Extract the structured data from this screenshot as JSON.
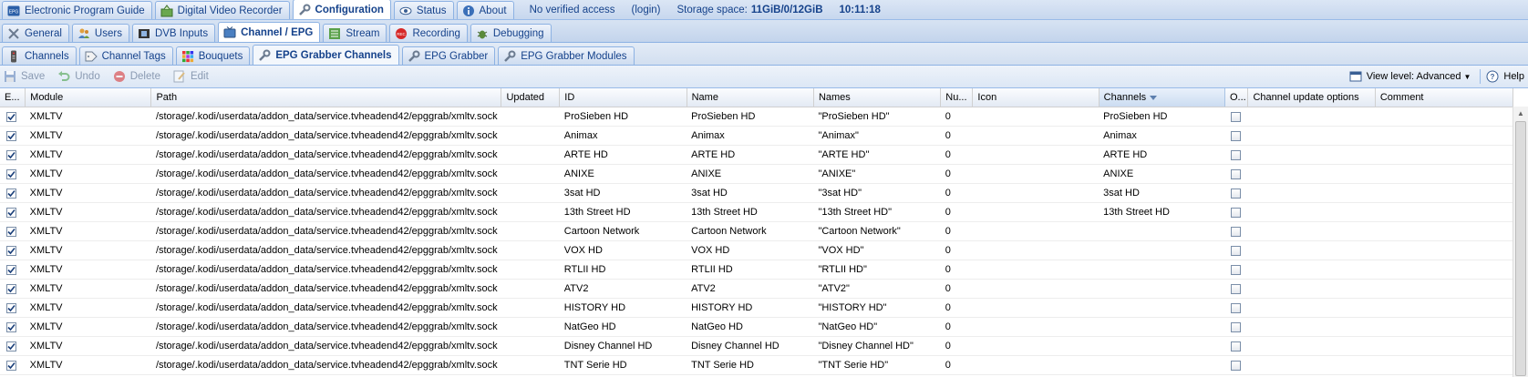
{
  "app": {
    "top_tabs": [
      {
        "label": "Electronic Program Guide",
        "icon": "epg-icon"
      },
      {
        "label": "Digital Video Recorder",
        "icon": "dvr-icon"
      },
      {
        "label": "Configuration",
        "icon": "wrench-icon"
      },
      {
        "label": "Status",
        "icon": "eye-icon"
      },
      {
        "label": "About",
        "icon": "info-icon"
      }
    ],
    "status": {
      "access": "No verified access",
      "login": "(login)",
      "storage_label": "Storage space:",
      "storage_value": "11GiB/0/12GiB",
      "clock": "10:11:18"
    }
  },
  "config_tabs": [
    {
      "label": "General",
      "icon": "tools-icon"
    },
    {
      "label": "Users",
      "icon": "users-icon"
    },
    {
      "label": "DVB Inputs",
      "icon": "film-icon"
    },
    {
      "label": "Channel / EPG",
      "icon": "tv-icon"
    },
    {
      "label": "Stream",
      "icon": "stream-icon"
    },
    {
      "label": "Recording",
      "icon": "rec-icon"
    },
    {
      "label": "Debugging",
      "icon": "bug-icon"
    }
  ],
  "sub_tabs": [
    {
      "label": "Channels",
      "icon": "remote-icon"
    },
    {
      "label": "Channel Tags",
      "icon": "tags-icon"
    },
    {
      "label": "Bouquets",
      "icon": "bouquet-icon"
    },
    {
      "label": "EPG Grabber Channels",
      "icon": "grabber-channels-icon"
    },
    {
      "label": "EPG Grabber",
      "icon": "grabber-icon"
    },
    {
      "label": "EPG Grabber Modules",
      "icon": "modules-icon"
    }
  ],
  "toolbar": {
    "save": "Save",
    "undo": "Undo",
    "delete": "Delete",
    "edit": "Edit",
    "view_level": "View level: Advanced",
    "help": "Help"
  },
  "grid": {
    "columns": [
      "E...",
      "Module",
      "Path",
      "Updated",
      "ID",
      "Name",
      "Names",
      "Nu...",
      "Icon",
      "Channels",
      "O...",
      "Channel update options",
      "Comment"
    ],
    "rows": [
      {
        "enabled": true,
        "module": "XMLTV",
        "path": "/storage/.kodi/userdata/addon_data/service.tvheadend42/epggrab/xmltv.sock",
        "updated": "",
        "id": "ProSieben HD",
        "name": "ProSieben HD",
        "names": "\"ProSieben HD\"",
        "num": "0",
        "icon": "",
        "channels": "ProSieben HD",
        "once": false,
        "options": "",
        "comment": ""
      },
      {
        "enabled": true,
        "module": "XMLTV",
        "path": "/storage/.kodi/userdata/addon_data/service.tvheadend42/epggrab/xmltv.sock",
        "updated": "",
        "id": "Animax",
        "name": "Animax",
        "names": "\"Animax\"",
        "num": "0",
        "icon": "",
        "channels": "Animax",
        "once": false,
        "options": "",
        "comment": ""
      },
      {
        "enabled": true,
        "module": "XMLTV",
        "path": "/storage/.kodi/userdata/addon_data/service.tvheadend42/epggrab/xmltv.sock",
        "updated": "",
        "id": "ARTE HD",
        "name": "ARTE HD",
        "names": "\"ARTE HD\"",
        "num": "0",
        "icon": "",
        "channels": "ARTE HD",
        "once": false,
        "options": "",
        "comment": ""
      },
      {
        "enabled": true,
        "module": "XMLTV",
        "path": "/storage/.kodi/userdata/addon_data/service.tvheadend42/epggrab/xmltv.sock",
        "updated": "",
        "id": "ANIXE",
        "name": "ANIXE",
        "names": "\"ANIXE\"",
        "num": "0",
        "icon": "",
        "channels": "ANIXE",
        "once": false,
        "options": "",
        "comment": ""
      },
      {
        "enabled": true,
        "module": "XMLTV",
        "path": "/storage/.kodi/userdata/addon_data/service.tvheadend42/epggrab/xmltv.sock",
        "updated": "",
        "id": "3sat HD",
        "name": "3sat HD",
        "names": "\"3sat HD\"",
        "num": "0",
        "icon": "",
        "channels": "3sat HD",
        "once": false,
        "options": "",
        "comment": ""
      },
      {
        "enabled": true,
        "module": "XMLTV",
        "path": "/storage/.kodi/userdata/addon_data/service.tvheadend42/epggrab/xmltv.sock",
        "updated": "",
        "id": "13th Street HD",
        "name": "13th Street HD",
        "names": "\"13th Street HD\"",
        "num": "0",
        "icon": "",
        "channels": "13th Street HD",
        "once": false,
        "options": "",
        "comment": ""
      },
      {
        "enabled": true,
        "module": "XMLTV",
        "path": "/storage/.kodi/userdata/addon_data/service.tvheadend42/epggrab/xmltv.sock",
        "updated": "",
        "id": "Cartoon Network",
        "name": "Cartoon Network",
        "names": "\"Cartoon Network\"",
        "num": "0",
        "icon": "",
        "channels": "",
        "once": false,
        "options": "",
        "comment": ""
      },
      {
        "enabled": true,
        "module": "XMLTV",
        "path": "/storage/.kodi/userdata/addon_data/service.tvheadend42/epggrab/xmltv.sock",
        "updated": "",
        "id": "VOX HD",
        "name": "VOX HD",
        "names": "\"VOX HD\"",
        "num": "0",
        "icon": "",
        "channels": "",
        "once": false,
        "options": "",
        "comment": ""
      },
      {
        "enabled": true,
        "module": "XMLTV",
        "path": "/storage/.kodi/userdata/addon_data/service.tvheadend42/epggrab/xmltv.sock",
        "updated": "",
        "id": "RTLII HD",
        "name": "RTLII HD",
        "names": "\"RTLII HD\"",
        "num": "0",
        "icon": "",
        "channels": "",
        "once": false,
        "options": "",
        "comment": ""
      },
      {
        "enabled": true,
        "module": "XMLTV",
        "path": "/storage/.kodi/userdata/addon_data/service.tvheadend42/epggrab/xmltv.sock",
        "updated": "",
        "id": "ATV2",
        "name": "ATV2",
        "names": "\"ATV2\"",
        "num": "0",
        "icon": "",
        "channels": "",
        "once": false,
        "options": "",
        "comment": ""
      },
      {
        "enabled": true,
        "module": "XMLTV",
        "path": "/storage/.kodi/userdata/addon_data/service.tvheadend42/epggrab/xmltv.sock",
        "updated": "",
        "id": "HISTORY HD",
        "name": "HISTORY HD",
        "names": "\"HISTORY HD\"",
        "num": "0",
        "icon": "",
        "channels": "",
        "once": false,
        "options": "",
        "comment": ""
      },
      {
        "enabled": true,
        "module": "XMLTV",
        "path": "/storage/.kodi/userdata/addon_data/service.tvheadend42/epggrab/xmltv.sock",
        "updated": "",
        "id": "NatGeo HD",
        "name": "NatGeo HD",
        "names": "\"NatGeo HD\"",
        "num": "0",
        "icon": "",
        "channels": "",
        "once": false,
        "options": "",
        "comment": ""
      },
      {
        "enabled": true,
        "module": "XMLTV",
        "path": "/storage/.kodi/userdata/addon_data/service.tvheadend42/epggrab/xmltv.sock",
        "updated": "",
        "id": "Disney Channel HD",
        "name": "Disney Channel HD",
        "names": "\"Disney Channel HD\"",
        "num": "0",
        "icon": "",
        "channels": "",
        "once": false,
        "options": "",
        "comment": ""
      },
      {
        "enabled": true,
        "module": "XMLTV",
        "path": "/storage/.kodi/userdata/addon_data/service.tvheadend42/epggrab/xmltv.sock",
        "updated": "",
        "id": "TNT Serie HD",
        "name": "TNT Serie HD",
        "names": "\"TNT Serie HD\"",
        "num": "0",
        "icon": "",
        "channels": "",
        "once": false,
        "options": "",
        "comment": ""
      }
    ]
  }
}
